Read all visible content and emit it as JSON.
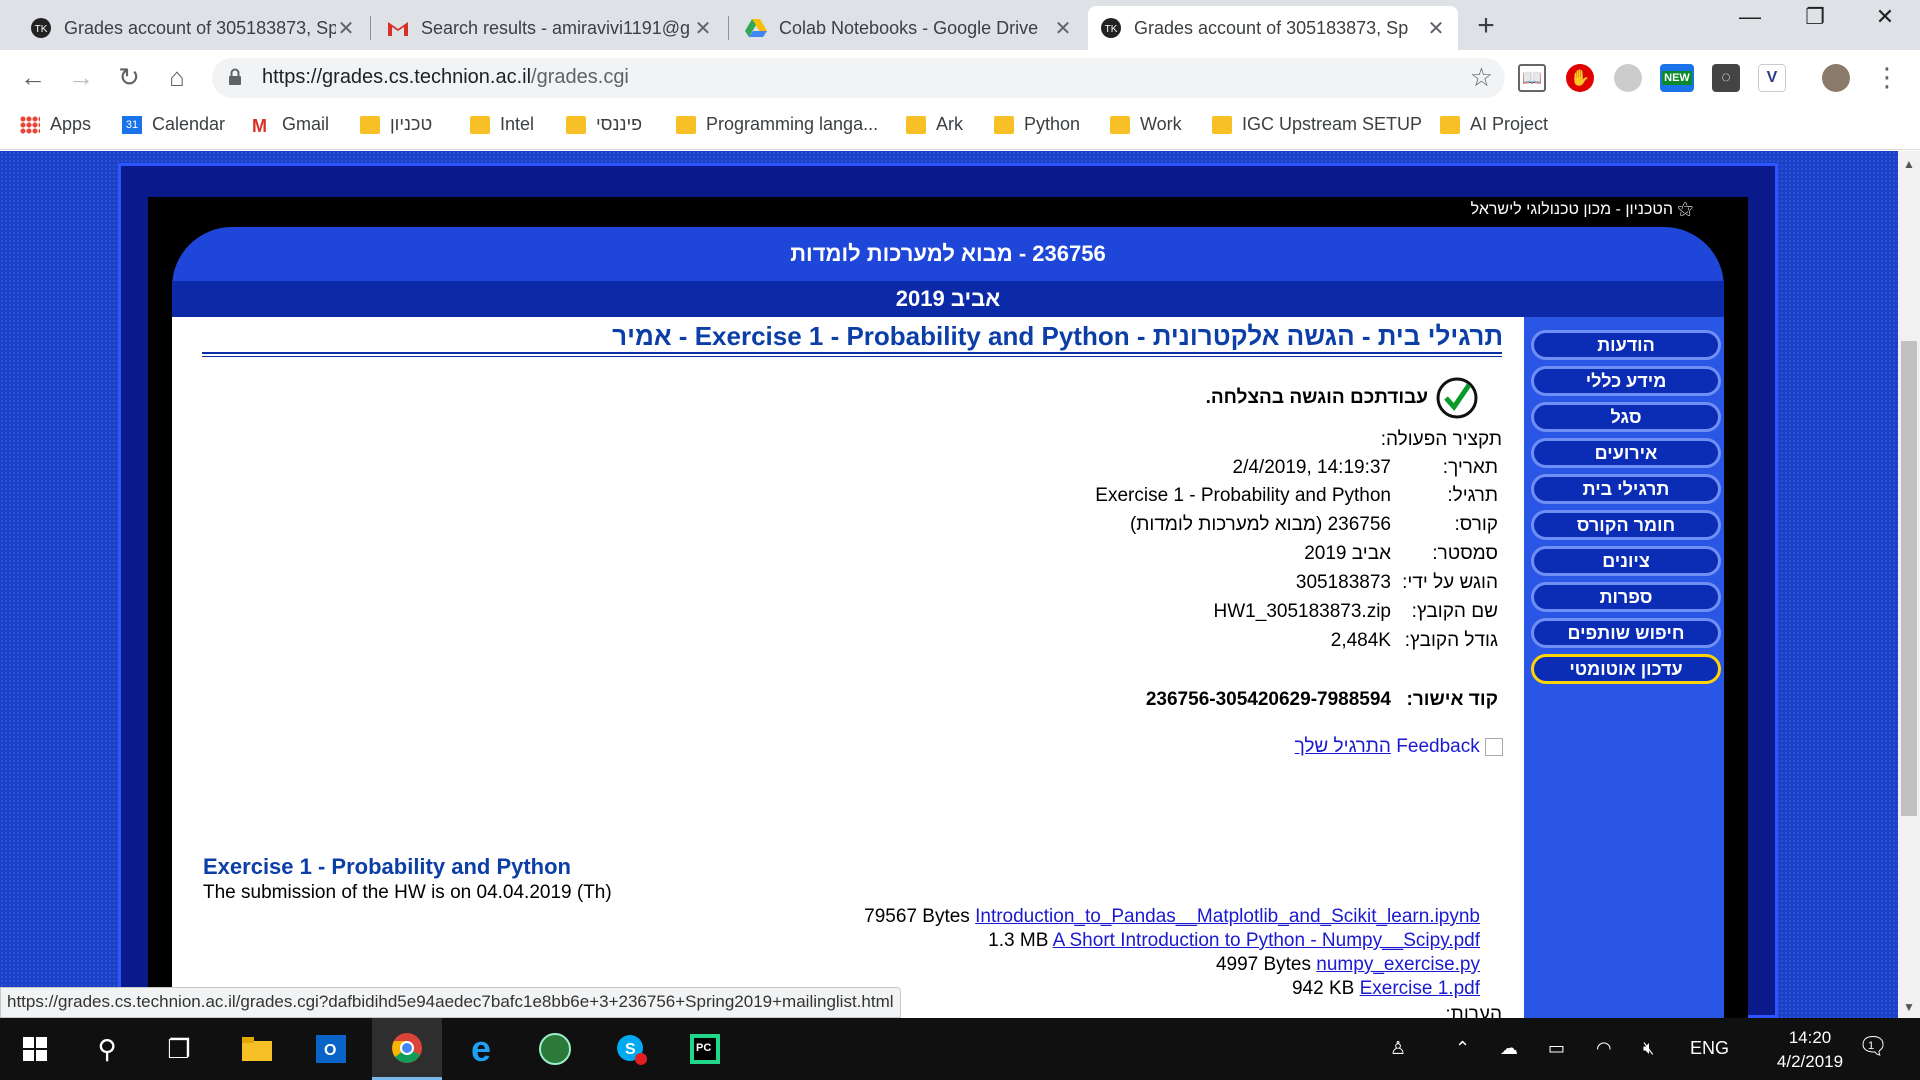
{
  "tabs": [
    {
      "title": "Grades account of 305183873, Sp",
      "icon": "tk-logo-icon",
      "active": false
    },
    {
      "title": "Search results - amiravivi1191@g",
      "icon": "gmail-icon",
      "active": false
    },
    {
      "title": "Colab Notebooks - Google Drive",
      "icon": "drive-icon",
      "active": false
    },
    {
      "title": "Grades account of 305183873, Sp",
      "icon": "tk-logo-icon",
      "active": true
    }
  ],
  "address": {
    "host": "https://grades.cs.technion.ac.il",
    "path": "/grades.cgi"
  },
  "bookmarks": [
    {
      "label": "Apps",
      "icon": "apps-grid-icon"
    },
    {
      "label": "Calendar",
      "icon": "calendar-icon"
    },
    {
      "label": "Gmail",
      "icon": "gmail-icon"
    },
    {
      "label": "טכניון",
      "icon": "folder-icon"
    },
    {
      "label": "Intel",
      "icon": "folder-icon"
    },
    {
      "label": "פיננסי",
      "icon": "folder-icon"
    },
    {
      "label": "Programming langa...",
      "icon": "folder-icon"
    },
    {
      "label": "Ark",
      "icon": "folder-icon"
    },
    {
      "label": "Python",
      "icon": "folder-icon"
    },
    {
      "label": "Work",
      "icon": "folder-icon"
    },
    {
      "label": "IGC Upstream SETUP",
      "icon": "folder-icon"
    },
    {
      "label": "AI Project",
      "icon": "folder-icon"
    }
  ],
  "calendar_day": "31",
  "site": {
    "technion_label": "הטכניון - מכון טכנולוגי לישראל",
    "course_header": "236756 - מבוא למערכות לומדות",
    "semester_header": "אביב 2019"
  },
  "menu": [
    "הודעות",
    "מידע כללי",
    "סגל",
    "אירועים",
    "תרגילי בית",
    "חומר הקורס",
    "ציונים",
    "ספרות",
    "חיפוש שותפים",
    "עדכון אוטומטי"
  ],
  "content": {
    "page_heading": "תרגילי בית - הגשה אלקטרונית - Exercise 1 - Probability and Python - אמיר",
    "success_msg": "עבודתכם הוגשה בהצלחה.",
    "summary_label": "תקציר הפעולה:",
    "rows": [
      {
        "label": "תאריך:",
        "value": "2/4/2019, 14:19:37"
      },
      {
        "label": "תרגיל:",
        "value": "Exercise 1 - Probability and Python"
      },
      {
        "label": "קורס:",
        "value": "236756 (מבוא למערכות לומדות)"
      },
      {
        "label": "סמסטר:",
        "value": "אביב 2019"
      },
      {
        "label": "הוגש על ידי:",
        "value": "305183873"
      },
      {
        "label": "שם הקובץ:",
        "value": "HW1_305183873.zip"
      },
      {
        "label": "גודל הקובץ:",
        "value": "2,484K"
      }
    ],
    "approval_label": "קוד אישור:",
    "approval_code": "236756-305420629-7988594",
    "feedback_text": "Feedback",
    "feedback_link": "התרגיל שלך",
    "exercise_title": "Exercise 1 - Probability and Python",
    "submission_note": "The submission of the HW is on 04.04.2019 (Th)",
    "files": [
      {
        "size": "79567 Bytes",
        "name": "Introduction_to_Pandas__Matplotlib_and_Scikit_learn.ipynb"
      },
      {
        "size": "1.3 MB",
        "name": "A Short Introduction to Python - Numpy__Scipy.pdf"
      },
      {
        "size": "4997 Bytes",
        "name": "numpy_exercise.py"
      },
      {
        "size": "942 KB",
        "name": "Exercise 1.pdf"
      }
    ],
    "notes_label": "הערות:"
  },
  "status_url": "https://grades.cs.technion.ac.il/grades.cgi?dafbidihd5e94aedec7bafc1e8bb6e+3+236756+Spring2019+mailinglist.html",
  "taskbar": {
    "lang": "ENG",
    "time": "14:20",
    "date": "4/2/2019",
    "notif_count": "1"
  },
  "ext_new_badge": "NEW",
  "colors": {
    "accent": "#1e46d8",
    "heading": "#0b3ea6",
    "menu_highlight": "#ffd400"
  }
}
